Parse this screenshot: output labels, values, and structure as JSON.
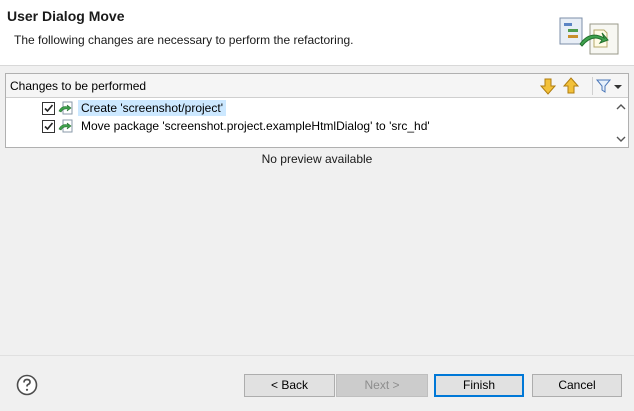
{
  "header": {
    "title": "User Dialog Move",
    "subtitle": "The following changes are necessary to perform the refactoring."
  },
  "changes": {
    "title": "Changes to be performed",
    "items": [
      {
        "label": "Create 'screenshot/project'",
        "checked": true,
        "selected": true
      },
      {
        "label": "Move package 'screenshot.project.exampleHtmlDialog' to 'src_hd'",
        "checked": true,
        "selected": false
      }
    ]
  },
  "preview": {
    "message": "No preview available"
  },
  "buttons": {
    "back": "< Back",
    "next": "Next >",
    "finish": "Finish",
    "cancel": "Cancel"
  },
  "icons": {
    "banner": "refactoring-wizard-icon",
    "down": "arrow-down-icon",
    "up": "arrow-up-icon",
    "filter": "filter-icon",
    "help": "help-icon",
    "change": "change-icon"
  },
  "colors": {
    "selection": "#cce8ff",
    "default_button_border": "#0078d7",
    "arrow_fill": "#f2c13a"
  }
}
